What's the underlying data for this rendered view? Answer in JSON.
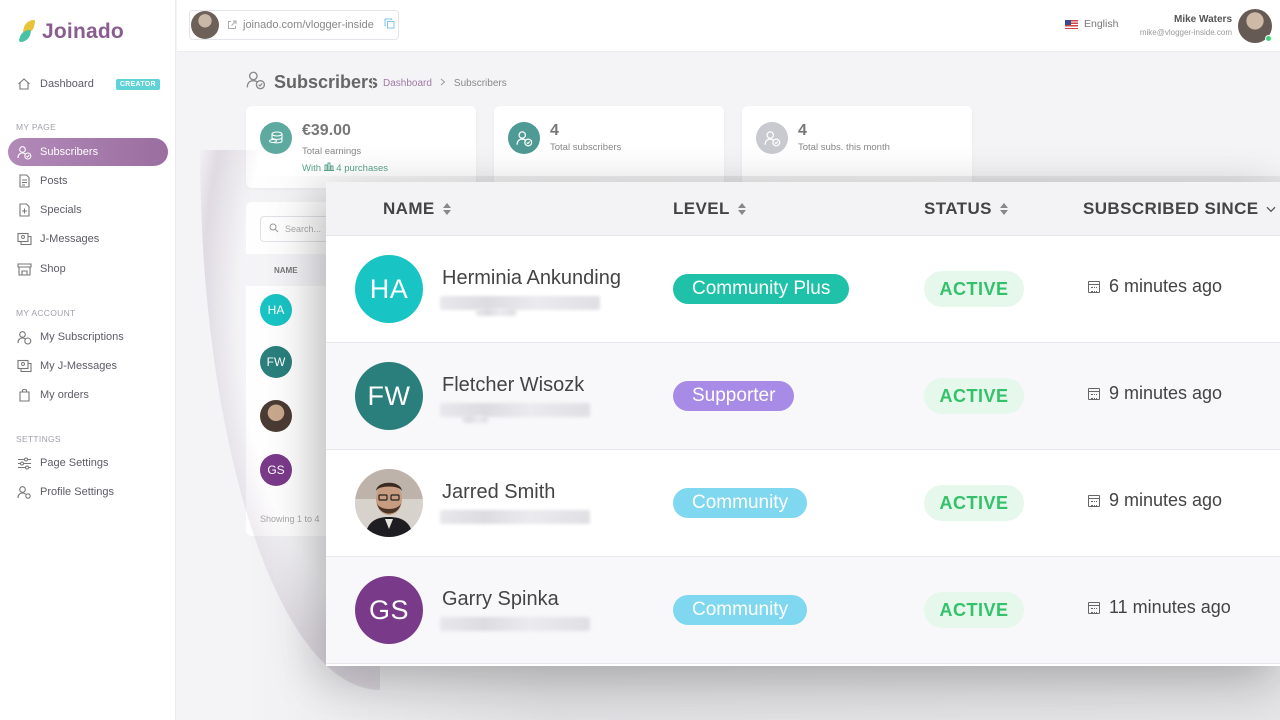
{
  "app": {
    "name": "Joinado"
  },
  "sidebar": {
    "dashboard": {
      "label": "Dashboard",
      "badge": "CREATOR"
    },
    "sections": {
      "my_page": "MY PAGE",
      "my_account": "MY ACCOUNT",
      "settings": "SETTINGS"
    },
    "items": [
      {
        "label": "Subscribers",
        "icon": "users-icon",
        "active": true
      },
      {
        "label": "Posts",
        "icon": "document-icon"
      },
      {
        "label": "Specials",
        "icon": "special-icon"
      },
      {
        "label": "J-Messages",
        "icon": "messages-icon"
      },
      {
        "label": "Shop",
        "icon": "shop-icon"
      },
      {
        "label": "My Subscriptions",
        "icon": "subscriptions-icon"
      },
      {
        "label": "My J-Messages",
        "icon": "messages-icon"
      },
      {
        "label": "My orders",
        "icon": "bag-icon"
      },
      {
        "label": "Page Settings",
        "icon": "sliders-icon"
      },
      {
        "label": "Profile Settings",
        "icon": "profile-settings-icon"
      }
    ]
  },
  "topbar": {
    "url": "joinado.com/vlogger-inside",
    "language": "English",
    "user_name": "Mike Waters",
    "user_email": "mike@vlogger-inside.com"
  },
  "page": {
    "title": "Subscribers",
    "breadcrumb": [
      "Dashboard",
      "Subscribers"
    ]
  },
  "stats": [
    {
      "value": "€39.00",
      "label": "Total earnings",
      "sub_prefix": "With",
      "sub_link": "4 purchases",
      "color": "#5ea9a0"
    },
    {
      "value": "4",
      "label": "Total subscribers",
      "color": "#4f9a94"
    },
    {
      "value": "4",
      "label": "Total subs. this month",
      "color": "#b8b8c0"
    }
  ],
  "background_table": {
    "search_placeholder": "Search...",
    "header": "NAME",
    "footer": "Showing 1 to 4"
  },
  "table": {
    "columns": [
      "NAME",
      "LEVEL",
      "STATUS",
      "SUBSCRIBED SINCE"
    ],
    "rows": [
      {
        "initials": "HA",
        "name": "Herminia Ankunding",
        "avatar_color": "#19c4c4",
        "level": "Community Plus",
        "level_color": "#1fc2a8",
        "status": "ACTIVE",
        "since": "6 minutes ago"
      },
      {
        "initials": "FW",
        "name": "Fletcher Wisozk",
        "avatar_color": "#2a7f7c",
        "level": "Supporter",
        "level_color": "#a88be6",
        "status": "ACTIVE",
        "since": "9 minutes ago"
      },
      {
        "initials": "",
        "name": "Jarred Smith",
        "avatar_color": "#7a6a60",
        "level": "Community",
        "level_color": "#7fd8ef",
        "status": "ACTIVE",
        "since": "9 minutes ago"
      },
      {
        "initials": "GS",
        "name": "Garry Spinka",
        "avatar_color": "#7a3a8a",
        "level": "Community",
        "level_color": "#7fd8ef",
        "status": "ACTIVE",
        "since": "11 minutes ago"
      }
    ]
  }
}
